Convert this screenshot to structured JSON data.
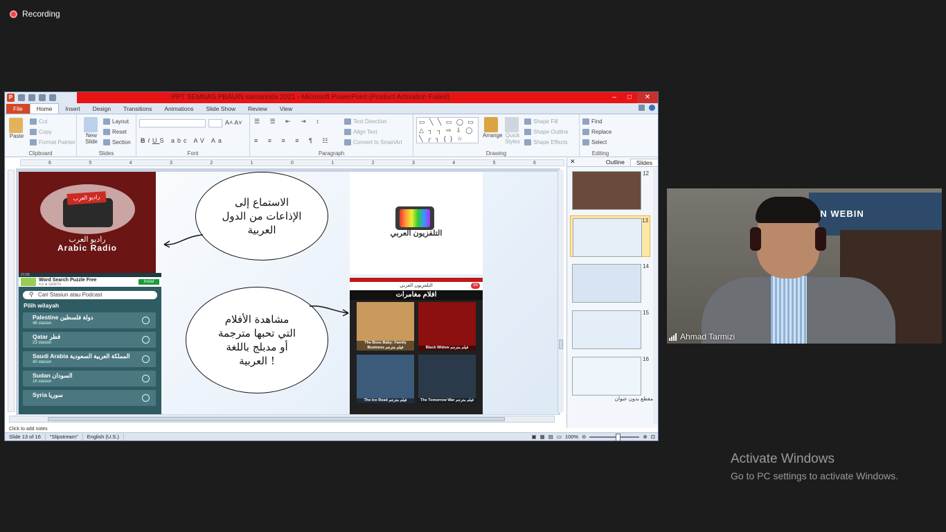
{
  "recording": {
    "label": "Recording"
  },
  "window": {
    "title": "PPT SEMNAS PBAUIN samarinda 2021 - Microsoft PowerPoint (Product Activation Failed)",
    "tabs": [
      "File",
      "Home",
      "Insert",
      "Design",
      "Transitions",
      "Animations",
      "Slide Show",
      "Review",
      "View"
    ],
    "active_tab": "Home"
  },
  "ribbon": {
    "clipboard": {
      "paste": "Paste",
      "cut": "Cut",
      "copy": "Copy",
      "format_painter": "Format Painter",
      "label": "Clipboard"
    },
    "slides": {
      "new_slide": "New Slide",
      "layout": "Layout",
      "reset": "Reset",
      "section": "Section",
      "label": "Slides"
    },
    "font": {
      "label": "Font"
    },
    "paragraph": {
      "text_direction": "Text Direction",
      "align_text": "Align Text",
      "convert": "Convert to SmartArt",
      "label": "Paragraph"
    },
    "drawing": {
      "arrange": "Arrange",
      "quick_styles": "Quick Styles",
      "shape_fill": "Shape Fill",
      "shape_outline": "Shape Outline",
      "shape_effects": "Shape Effects",
      "label": "Drawing"
    },
    "editing": {
      "find": "Find",
      "replace": "Replace",
      "select": "Select",
      "label": "Editing"
    }
  },
  "ruler": {
    "numbers": [
      "6",
      "5",
      "4",
      "3",
      "2",
      "1",
      "0",
      "1",
      "2",
      "3",
      "4",
      "5",
      "6"
    ]
  },
  "slide": {
    "radio": {
      "flag": "راديو العرب",
      "arabic": "راديو العرب",
      "english": "Arabic Radio"
    },
    "bubble_top": {
      "line1": "الاستماع إلى",
      "line2": "الإذاعات من الدول",
      "line3": "العربية"
    },
    "bubble_bottom": {
      "line1": "مشاهدة الأفلام",
      "line2": "التي تحبها مترجمة",
      "line3": "أو مدبلج باللغة",
      "line4": "العربية !"
    },
    "tv_label": "التلفزيون العربي",
    "phone": {
      "status": "21:59",
      "ad_title": "Word Search Puzzle Free",
      "ad_sub": "4.6 ★ GRATIS",
      "install": "Instal",
      "search": "Cari Stasiun atau Podcast",
      "section": "Pilih wilayah",
      "rows": [
        {
          "name": "Palestine دولة فلسطين",
          "count": "48 stasiun"
        },
        {
          "name": "Qatar قطر",
          "count": "23 stasiun"
        },
        {
          "name": "Saudi Arabia المملكة العربية السعودية",
          "count": "40 stasiun"
        },
        {
          "name": "Sudan السودان",
          "count": "16 stasiun"
        },
        {
          "name": "Syria سوريا",
          "count": ""
        }
      ]
    },
    "movies": {
      "header": "التلفزيون العربي",
      "badge": "55",
      "title": "افلام مغامرات",
      "cards": [
        {
          "caption": "The Boss Baby: Family Business فيلم مترجم",
          "color": "#c99a5b"
        },
        {
          "caption": "Black Widow فيلم مترجم",
          "color": "#8c1010"
        },
        {
          "caption": "The Ice Road فيلم مترجم",
          "color": "#3c5a7a"
        },
        {
          "caption": "The Tomorrow War فيلم مترجم",
          "color": "#2a3a4a"
        }
      ]
    }
  },
  "pane": {
    "tabs": [
      "Outline",
      "Slides"
    ],
    "active": "Slides",
    "thumbs": [
      {
        "num": "12",
        "color": "#6a4a3a"
      },
      {
        "num": "13",
        "color": "#e6eef8"
      },
      {
        "num": "14",
        "color": "#d8e4f2"
      },
      {
        "num": "15",
        "color": "#e3eef9"
      },
      {
        "num": "16",
        "color": "#eef6fb"
      }
    ],
    "selected": "13",
    "footer": "مقطع بدون عنوان"
  },
  "status": {
    "slide": "Slide 13 of 16",
    "theme": "\"Slipstream\"",
    "lang": "English (U.S.)",
    "zoom": "100%",
    "notes": "Click to add notes"
  },
  "webcam": {
    "name": "Ahmad Tarmizi",
    "banner": "AN WEBIN"
  },
  "activate": {
    "title": "Activate Windows",
    "sub": "Go to PC settings to activate Windows."
  }
}
